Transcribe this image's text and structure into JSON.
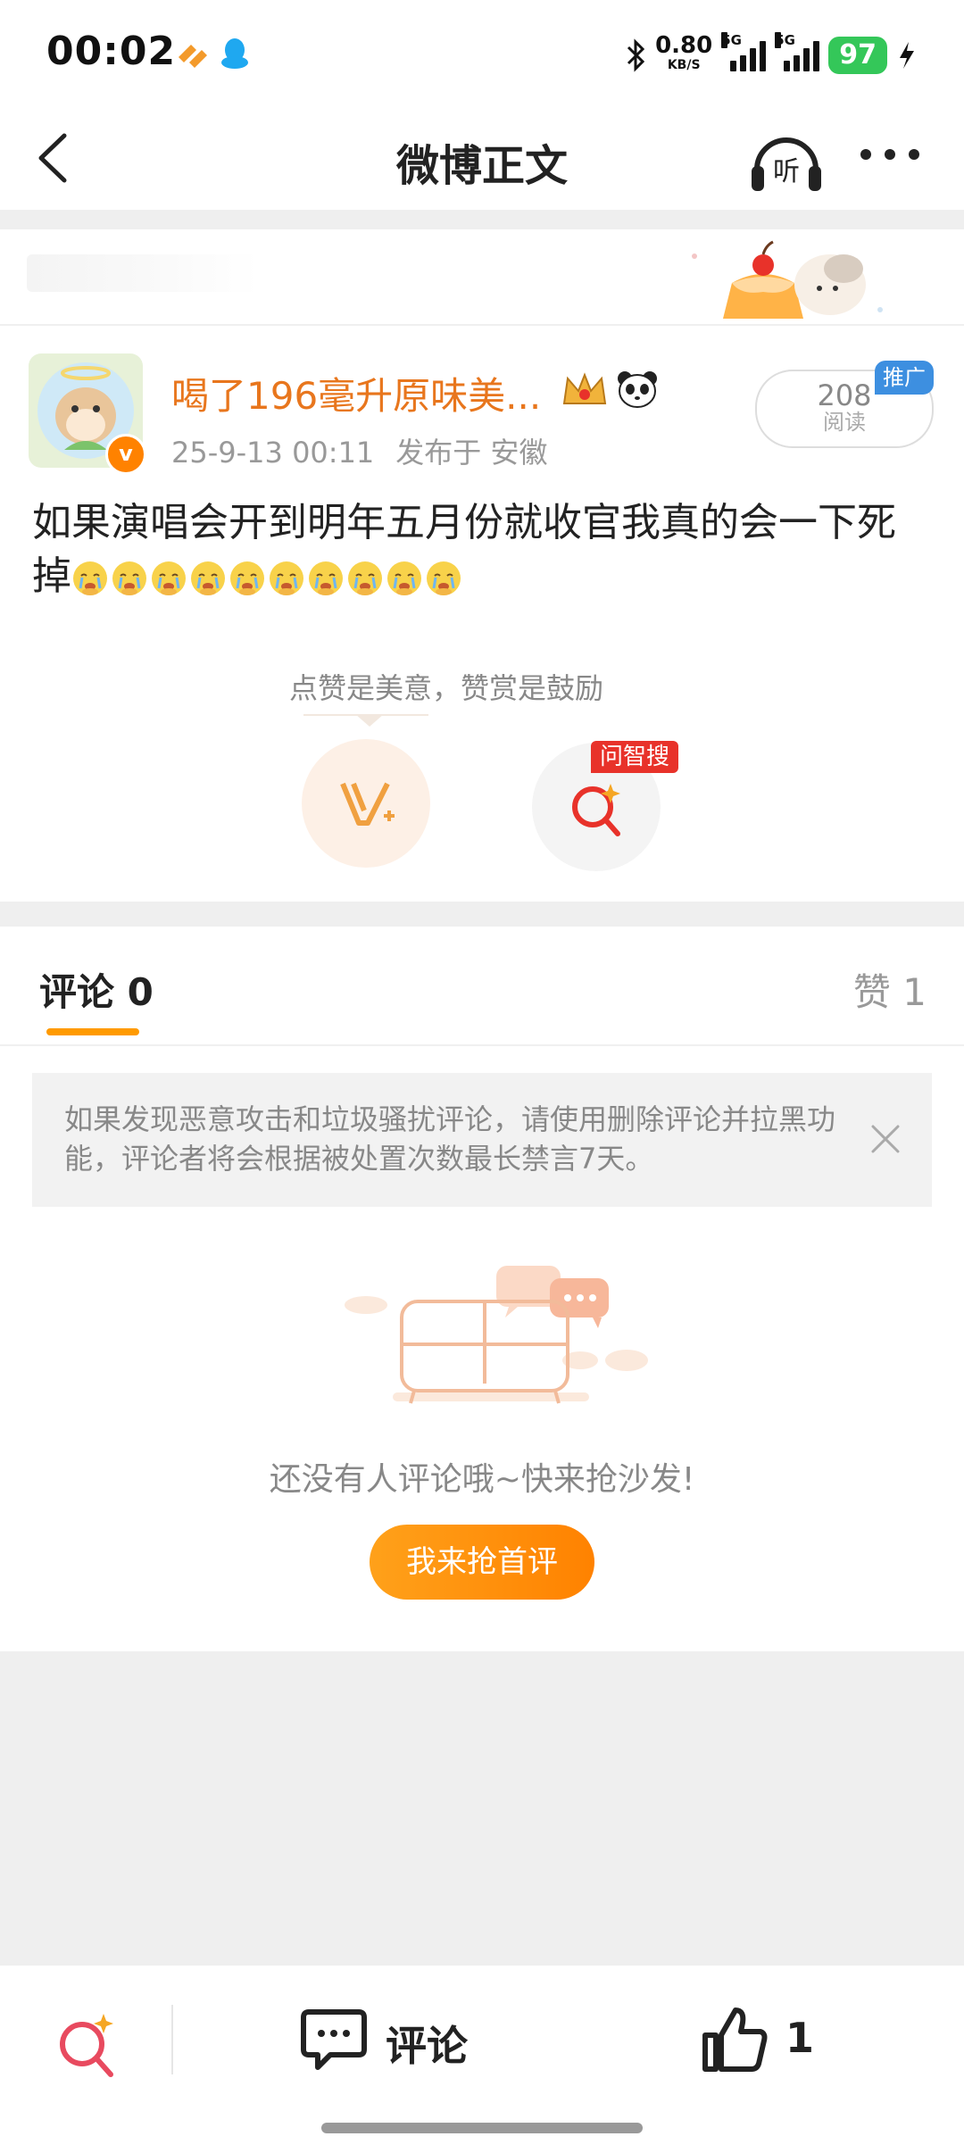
{
  "status_bar": {
    "time": "00:02",
    "net_speed": "0.80",
    "net_unit": "KB/S",
    "sig1_label": "5G",
    "sig2_label": "5G",
    "battery": "97"
  },
  "nav": {
    "title": "微博正文",
    "listen_label": "听"
  },
  "post": {
    "username": "喝了196毫升原味美...",
    "verified_mark": "v",
    "timestamp": "25-9-13 00:11",
    "location": "发布于 安徽",
    "reads_count": "208",
    "reads_label": "阅读",
    "promo_label": "推广",
    "content": "如果演唱会开到明年五月份就收官我真的会一下死掉",
    "emoji_count": 10
  },
  "reward": {
    "tip": "点赞是美意，赞赏是鼓励",
    "ask_badge": "问智搜"
  },
  "comments_tab": {
    "comments_label": "评论 0",
    "likes_label": "赞 1"
  },
  "notice": {
    "text": "如果发现恶意攻击和垃圾骚扰评论，请使用删除评论并拉黑功能，评论者将会根据被处置次数最长禁言7天。"
  },
  "empty": {
    "text": "还没有人评论哦~快来抢沙发!",
    "button": "我来抢首评"
  },
  "bottom_bar": {
    "comment_label": "评论",
    "like_count": "1"
  },
  "colors": {
    "accent_orange": "#ff8200",
    "username_orange": "#e8761d",
    "battery_green": "#34c759",
    "promo_blue": "#3d8fe0",
    "badge_red": "#e8322a"
  }
}
